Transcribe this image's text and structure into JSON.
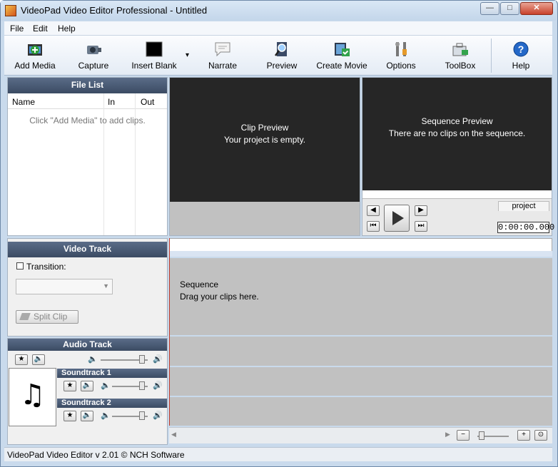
{
  "window": {
    "title": "VideoPad Video Editor Professional - Untitled",
    "min": "—",
    "max": "□",
    "close": "✕"
  },
  "menu": [
    "File",
    "Edit",
    "Help"
  ],
  "toolbar": {
    "items": [
      {
        "label": "Add Media",
        "icon": "film-add-icon"
      },
      {
        "label": "Capture",
        "icon": "camera-icon"
      },
      {
        "label": "Insert Blank",
        "icon": "black-frame-icon"
      },
      {
        "label": "Narrate",
        "icon": "speech-bubble-icon"
      },
      {
        "label": "Preview",
        "icon": "magnifier-film-icon"
      },
      {
        "label": "Create Movie",
        "icon": "film-check-icon"
      },
      {
        "label": "Options",
        "icon": "tools-icon"
      },
      {
        "label": "ToolBox",
        "icon": "toolbox-icon"
      },
      {
        "label": "Help",
        "icon": "help-icon"
      }
    ],
    "dropdown_arrow": "▾"
  },
  "file_list": {
    "title": "File List",
    "columns": [
      "Name",
      "In",
      "Out"
    ],
    "empty_text": "Click \"Add Media\" to add clips."
  },
  "clip_preview": {
    "title": "Clip Preview",
    "message": "Your project is empty."
  },
  "sequence_preview": {
    "title": "Sequence Preview",
    "message": "There are no clips on the sequence.",
    "tab": "project",
    "timecode": "0:00:00.000"
  },
  "video_track": {
    "title": "Video Track",
    "transition_label": "Transition:",
    "split_clip": "Split Clip"
  },
  "sequence": {
    "title": "Sequence",
    "hint": "Drag your clips here."
  },
  "audio_track": {
    "title": "Audio Track",
    "soundtracks": [
      "Soundtrack 1",
      "Soundtrack 2"
    ],
    "note_glyph": "♫"
  },
  "status": {
    "text": "VideoPad Video Editor v 2.01 © NCH Software"
  },
  "colors": {
    "accent": "#3b4b63",
    "preview_bg": "#262626",
    "track_bg": "#c1c1c1",
    "playhead": "#c0392b"
  }
}
